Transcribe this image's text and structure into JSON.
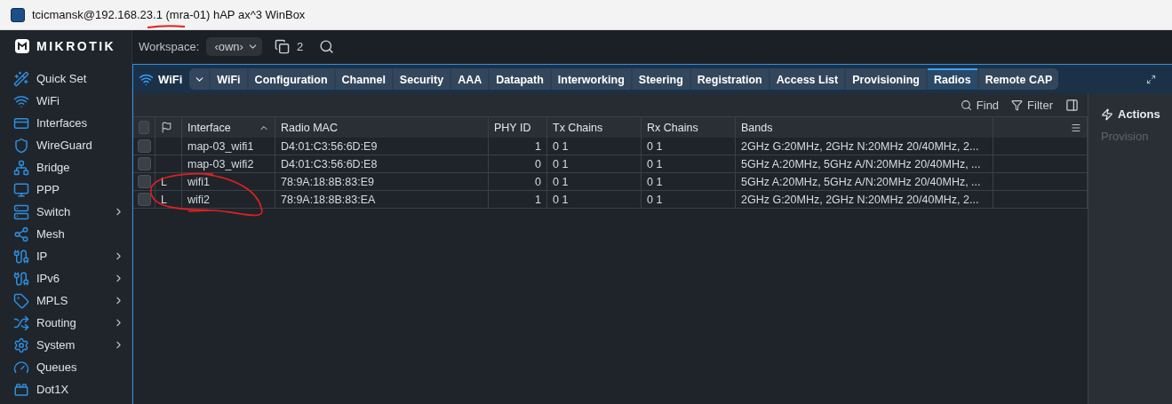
{
  "window": {
    "title": "tcicmansk@192.168.23.1 (mra-01) hAP ax^3 WinBox"
  },
  "brand": {
    "logo": "MIKROTIK"
  },
  "sidebar": {
    "items": [
      {
        "label": "Quick Set",
        "submenu": false
      },
      {
        "label": "WiFi",
        "submenu": false
      },
      {
        "label": "Interfaces",
        "submenu": false
      },
      {
        "label": "WireGuard",
        "submenu": false
      },
      {
        "label": "Bridge",
        "submenu": false
      },
      {
        "label": "PPP",
        "submenu": false
      },
      {
        "label": "Switch",
        "submenu": true
      },
      {
        "label": "Mesh",
        "submenu": false
      },
      {
        "label": "IP",
        "submenu": true
      },
      {
        "label": "IPv6",
        "submenu": true
      },
      {
        "label": "MPLS",
        "submenu": true
      },
      {
        "label": "Routing",
        "submenu": true
      },
      {
        "label": "System",
        "submenu": true
      },
      {
        "label": "Queues",
        "submenu": false
      },
      {
        "label": "Dot1X",
        "submenu": false
      }
    ]
  },
  "toolbar": {
    "workspace_label": "Workspace:",
    "workspace_value": "‹own›",
    "window_count": "2"
  },
  "panel": {
    "title": "WiFi",
    "tabs": [
      {
        "label": "WiFi",
        "selected": false
      },
      {
        "label": "Configuration",
        "selected": false
      },
      {
        "label": "Channel",
        "selected": false
      },
      {
        "label": "Security",
        "selected": false
      },
      {
        "label": "AAA",
        "selected": false
      },
      {
        "label": "Datapath",
        "selected": false
      },
      {
        "label": "Interworking",
        "selected": false
      },
      {
        "label": "Steering",
        "selected": false
      },
      {
        "label": "Registration",
        "selected": false
      },
      {
        "label": "Access List",
        "selected": false
      },
      {
        "label": "Provisioning",
        "selected": false
      },
      {
        "label": "Radios",
        "selected": true
      },
      {
        "label": "Remote CAP",
        "selected": false
      }
    ],
    "find": "Find",
    "filter": "Filter",
    "actions": {
      "title": "Actions",
      "items": [
        {
          "label": "Provision",
          "disabled": true
        }
      ]
    }
  },
  "table": {
    "all_checked": false,
    "columns": [
      {
        "label": "Interface",
        "sorted": true
      },
      {
        "label": "Radio MAC",
        "sorted": false
      },
      {
        "label": "PHY ID",
        "sorted": false
      },
      {
        "label": "Tx Chains",
        "sorted": false
      },
      {
        "label": "Rx Chains",
        "sorted": false
      },
      {
        "label": "Bands",
        "sorted": false
      }
    ],
    "rows": [
      {
        "checked": false,
        "flag": "",
        "cells": [
          "map-03_wifi1",
          "D4:01:C3:56:6D:E9",
          "1",
          "0 1",
          "0 1",
          "2GHz G:20MHz, 2GHz N:20MHz 20/40MHz, 2..."
        ]
      },
      {
        "checked": false,
        "flag": "",
        "cells": [
          "map-03_wifi2",
          "D4:01:C3:56:6D:E8",
          "0",
          "0 1",
          "0 1",
          "5GHz A:20MHz, 5GHz A/N:20MHz 20/40MHz, ..."
        ]
      },
      {
        "checked": false,
        "flag": "L",
        "cells": [
          "wifi1",
          "78:9A:18:8B:83:E9",
          "0",
          "0 1",
          "0 1",
          "5GHz A:20MHz, 5GHz A/N:20MHz 20/40MHz, ..."
        ]
      },
      {
        "checked": false,
        "flag": "L",
        "cells": [
          "wifi2",
          "78:9A:18:8B:83:EA",
          "1",
          "0 1",
          "0 1",
          "2GHz G:20MHz, 2GHz N:20MHz 20/40MHz, 2..."
        ]
      }
    ]
  }
}
